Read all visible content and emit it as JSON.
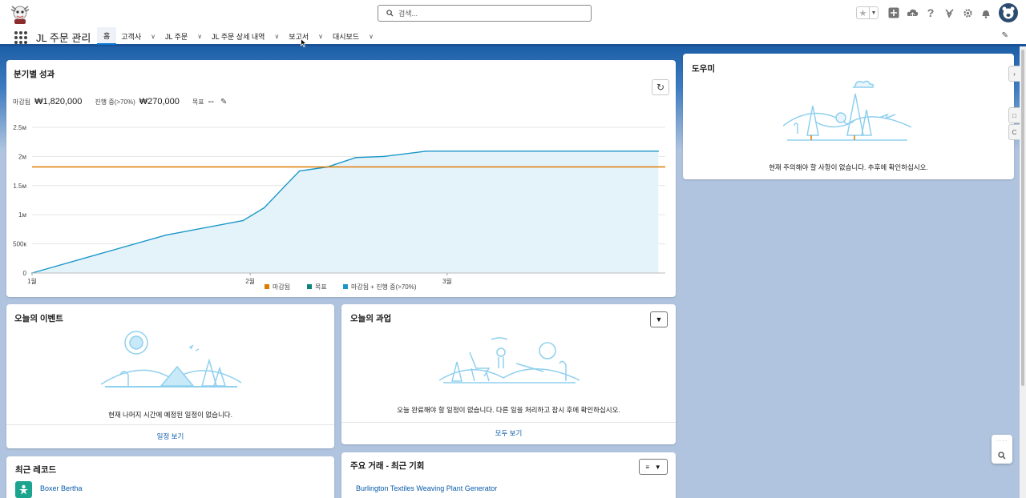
{
  "header": {
    "search_placeholder": "검색..."
  },
  "nav": {
    "app_name": "JL 주문 관리",
    "tabs": [
      {
        "label": "홈",
        "active": true
      },
      {
        "label": "고객사",
        "active": false
      },
      {
        "label": "JL 주문",
        "active": false
      },
      {
        "label": "JL 주문 상세 내역",
        "active": false
      },
      {
        "label": "보고서",
        "active": false
      },
      {
        "label": "대시보드",
        "active": false
      }
    ]
  },
  "performance": {
    "title": "분기별 성과",
    "closed_label": "마감됨",
    "closed_value": "₩1,820,000",
    "open_label": "진행 중(>70%)",
    "open_value": "₩270,000",
    "goal_label": "목표",
    "goal_value": "--"
  },
  "chart_data": {
    "type": "line",
    "x_ticks": [
      "1월",
      "2월",
      "3월"
    ],
    "y_ticks": [
      "2.5м",
      "2м",
      "1.5м",
      "1м",
      "500к",
      "0"
    ],
    "ylim": [
      0,
      2500000
    ],
    "grid": true,
    "legend_position": "bottom",
    "series": [
      {
        "name": "마감됨",
        "color": "#dd7a01",
        "x": [
          "1월",
          "3월 말"
        ],
        "values": [
          1820000,
          1820000
        ]
      },
      {
        "name": "목표",
        "color": "#0c8477",
        "x": [],
        "values": []
      },
      {
        "name": "마감됨 + 진행 중(>70%)",
        "color": "#1b96c8",
        "x": [
          "1월 1일",
          "1월 20일",
          "1월 31일",
          "2월 3일",
          "2월 6일",
          "2월 8일",
          "2월 12일",
          "2월 13일",
          "2월 16일",
          "2월 20일",
          "2월 26일",
          "3월 31일"
        ],
        "values": [
          0,
          650000,
          900000,
          1120000,
          1500000,
          1750000,
          1820000,
          1860000,
          1980000,
          2000000,
          2090000,
          2090000
        ]
      }
    ]
  },
  "assistant": {
    "title": "도우미",
    "message": "현재 주의해야 할 사항이 없습니다. 추후에 확인하십시오."
  },
  "events": {
    "title": "오늘의 이벤트",
    "message": "현재 나머지 시간에 예정된 일정이 없습니다.",
    "footer_link": "일정 보기"
  },
  "tasks": {
    "title": "오늘의 과업",
    "message": "오늘 완료해야 할 일정이 없습니다. 다른 일을 처리하고 잠시 후에 확인하십시오.",
    "footer_link": "모두 보기"
  },
  "recent": {
    "title": "최근 레코드",
    "items": [
      {
        "label": "Boxer Bertha"
      }
    ]
  },
  "deals": {
    "title": "주요 거래 - 최근 기회",
    "items": [
      {
        "label": "Burlington Textiles Weaving Plant Generator"
      }
    ]
  },
  "colors": {
    "brand": "#0176d3",
    "link": "#0b5cab",
    "closed": "#dd7a01",
    "goal": "#0c8477",
    "closed_plus_open": "#1b96c8"
  }
}
